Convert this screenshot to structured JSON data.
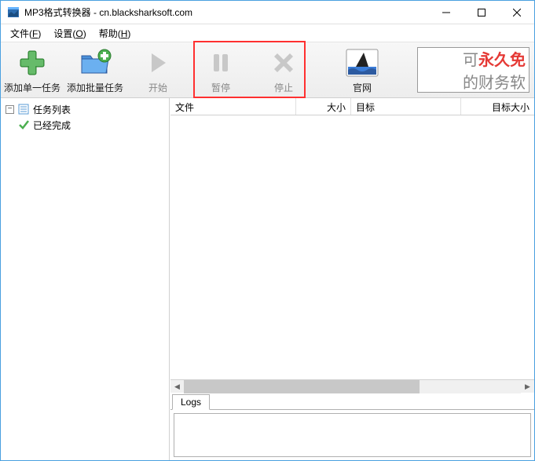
{
  "window": {
    "title": "MP3格式转换器 - cn.blacksharksoft.com"
  },
  "menu": {
    "file": "文件(",
    "file_key": "F",
    "file_end": ")",
    "settings": "设置(",
    "settings_key": "O",
    "settings_end": ")",
    "help": "帮助(",
    "help_key": "H",
    "help_end": ")"
  },
  "toolbar": {
    "add_single": "添加单一任务",
    "add_batch": "添加批量任务",
    "start": "开始",
    "pause": "暂停",
    "stop": "停止",
    "website": "官网"
  },
  "ad": {
    "line1_prefix": "可",
    "line1_red": "永久免",
    "line2": "的财务软"
  },
  "tree": {
    "task_list": "任务列表",
    "completed": "已经完成"
  },
  "columns": {
    "file": "文件",
    "size": "大小",
    "target": "目标",
    "target_size": "目标大小"
  },
  "tabs": {
    "logs": "Logs"
  }
}
